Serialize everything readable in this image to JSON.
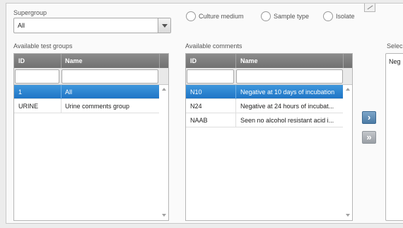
{
  "supergroup": {
    "label": "Supergroup",
    "value": "All"
  },
  "radios": [
    {
      "label": "Culture medium"
    },
    {
      "label": "Sample type"
    },
    {
      "label": "Isolate"
    }
  ],
  "test_groups": {
    "label": "Available test groups",
    "columns": [
      "ID",
      "Name"
    ],
    "rows": [
      {
        "id": "1",
        "name": "All",
        "selected": true
      },
      {
        "id": "URINE",
        "name": "Urine comments group",
        "selected": false
      }
    ]
  },
  "comments": {
    "label": "Available comments",
    "columns": [
      "ID",
      "Name"
    ],
    "rows": [
      {
        "id": "N10",
        "name": "Negative at 10 days of incubation",
        "selected": true
      },
      {
        "id": "N24",
        "name": "Negative  at 24 hours of incubat...",
        "selected": false
      },
      {
        "id": "NAAB",
        "name": "Seen no alcohol resistant acid i...",
        "selected": false
      }
    ]
  },
  "buttons": {
    "add_one": "›",
    "add_all": "»"
  },
  "selected": {
    "label": "Selec",
    "text": "Neg"
  }
}
